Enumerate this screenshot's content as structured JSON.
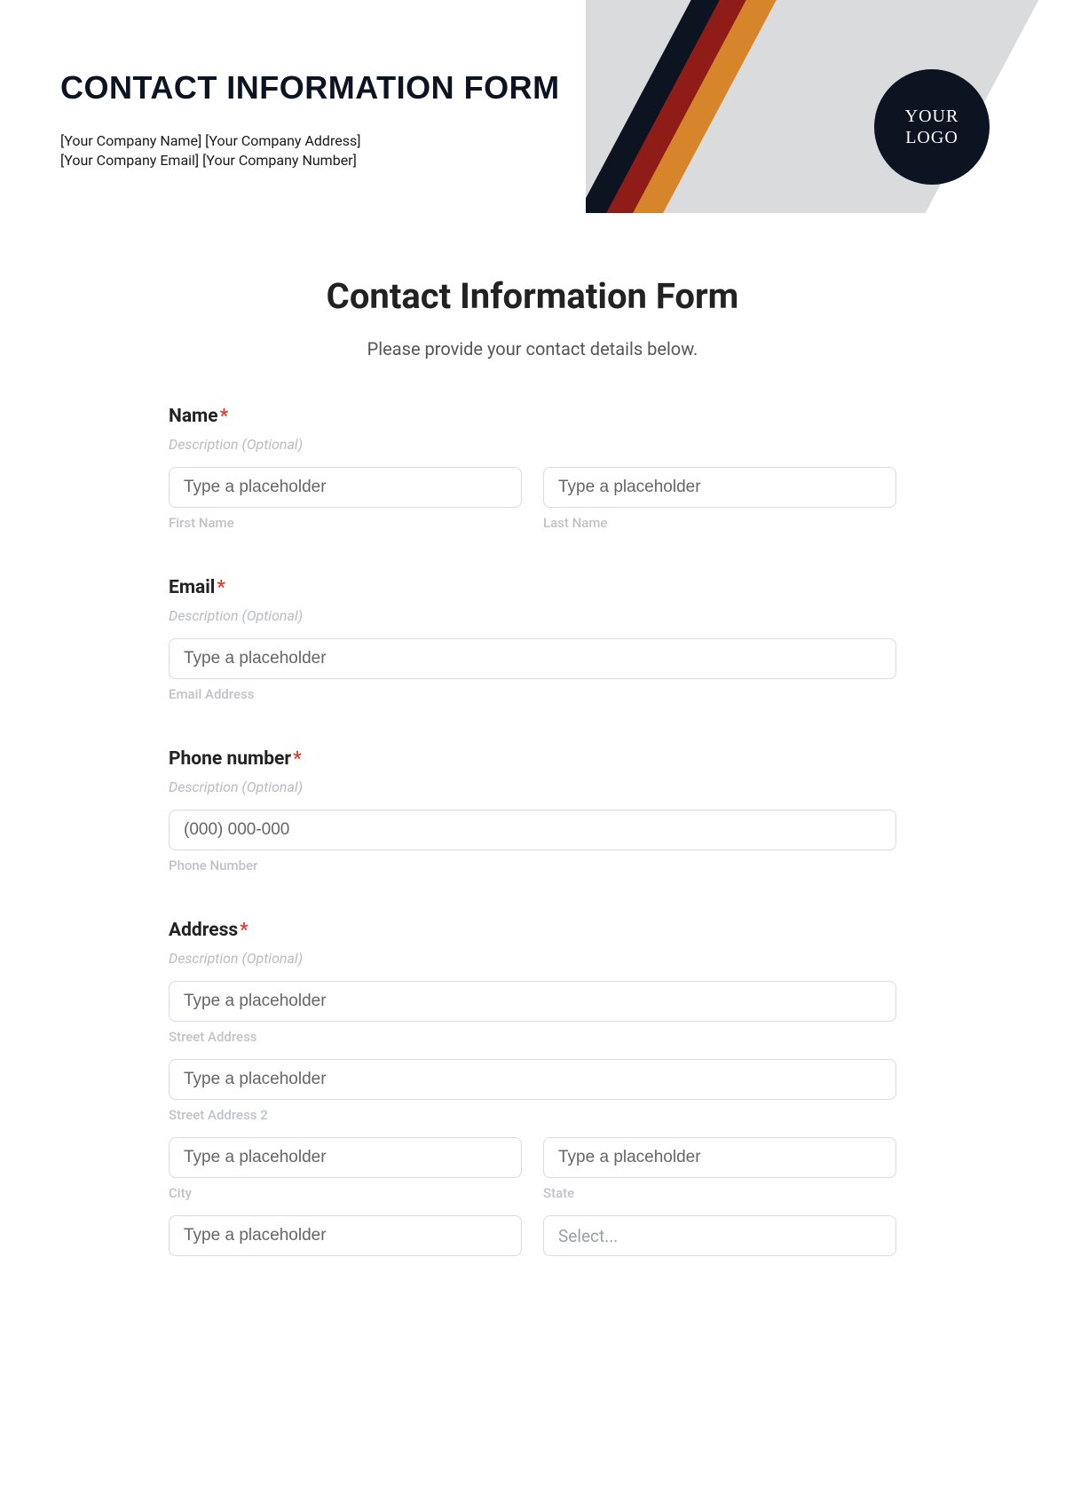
{
  "header": {
    "title": "CONTACT INFORMATION FORM",
    "company_line1": "[Your Company Name] [Your Company Address]",
    "company_line2": "[Your Company Email] [Your Company Number]",
    "logo_line1": "YOUR",
    "logo_line2": "LOGO"
  },
  "form": {
    "title": "Contact Information Form",
    "subtitle": "Please provide your contact details below.",
    "desc_placeholder": "Description (Optional)",
    "generic_placeholder": "Type a placeholder",
    "name": {
      "label": "Name",
      "first_sub": "First Name",
      "last_sub": "Last Name"
    },
    "email": {
      "label": "Email",
      "sub": "Email Address"
    },
    "phone": {
      "label": "Phone number",
      "placeholder": "(000) 000-000",
      "sub": "Phone Number"
    },
    "address": {
      "label": "Address",
      "street_sub": "Street Address",
      "street2_sub": "Street Address 2",
      "city_sub": "City",
      "state_sub": "State",
      "select_placeholder": "Select..."
    }
  }
}
